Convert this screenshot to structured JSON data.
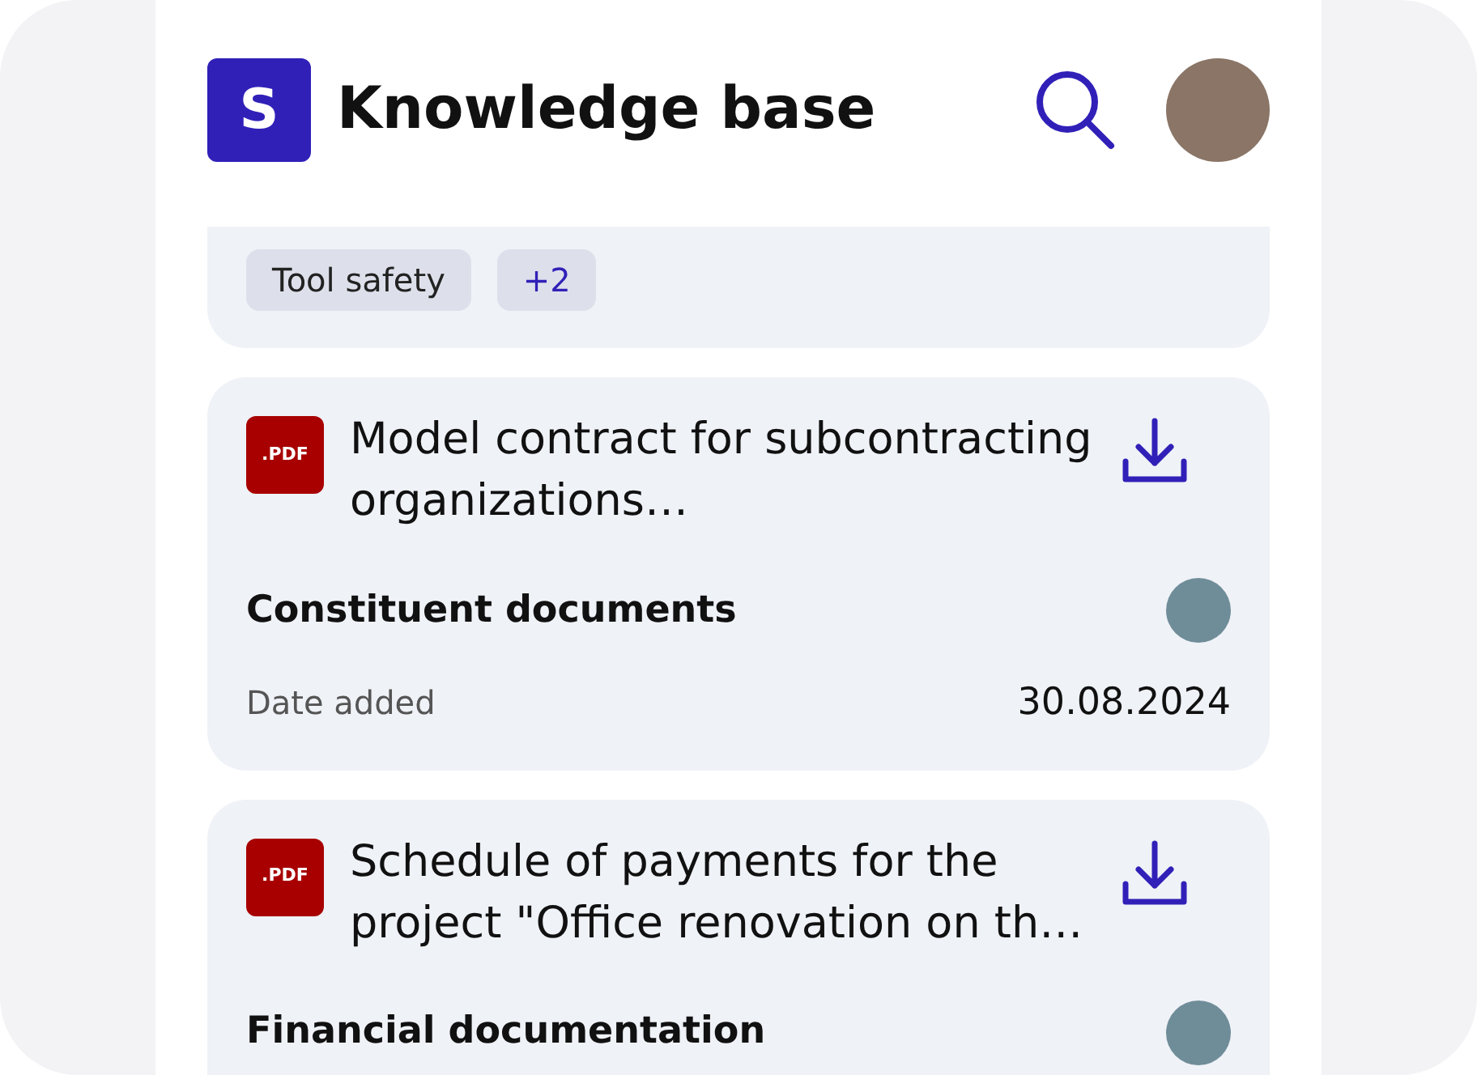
{
  "header": {
    "logo_letter": "S",
    "title": "Knowledge base"
  },
  "tags": [
    {
      "label": "Tool safety",
      "kind": "tag"
    },
    {
      "label": "+2",
      "kind": "more"
    }
  ],
  "documents": [
    {
      "file_type": ".PDF",
      "title": "Model contract for subcontracting organizations…",
      "category": "Constituent documents",
      "date_label": "Date added",
      "date": "30.08.2024"
    },
    {
      "file_type": ".PDF",
      "title": "Schedule of payments for the project \"Office renovation on th…",
      "category": "Financial documentation"
    }
  ]
}
